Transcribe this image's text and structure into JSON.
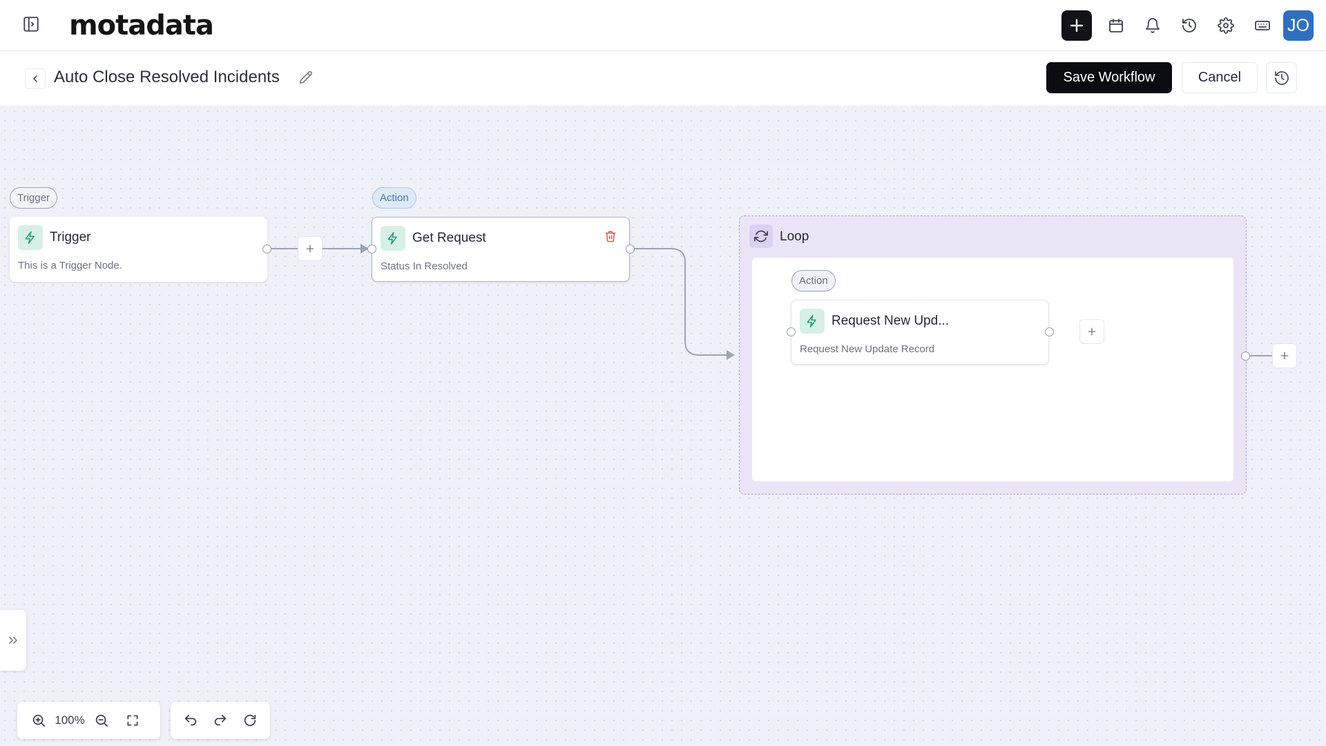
{
  "app": {
    "logo_text": "motadata",
    "avatar_initials": "JO",
    "icons": [
      "sidebar-toggle-icon",
      "plus-icon",
      "calendar-icon",
      "bell-icon",
      "history-icon",
      "gear-icon",
      "keyboard-icon"
    ]
  },
  "workflow": {
    "title": "Auto Close Resolved Incidents",
    "save_label": "Save Workflow",
    "cancel_label": "Cancel"
  },
  "canvas": {
    "trigger_node": {
      "badge": "Trigger",
      "title": "Trigger",
      "subtitle": "This is a Trigger Node."
    },
    "action_node": {
      "badge": "Action",
      "title": "Get Request",
      "subtitle": "Status In Resolved"
    },
    "loop_node": {
      "title": "Loop",
      "inner_action": {
        "badge": "Action",
        "title": "Request New Upd...",
        "subtitle": "Request New Update Record"
      }
    },
    "zoom_level": "100%"
  },
  "colors": {
    "primary_button": "#0a0c12",
    "avatar": "#2f6fbf",
    "canvas_bg": "#eef1f8",
    "loop_bg": "#ebe4f7",
    "action_badge": "#dce9f7",
    "delete": "#e05252"
  }
}
